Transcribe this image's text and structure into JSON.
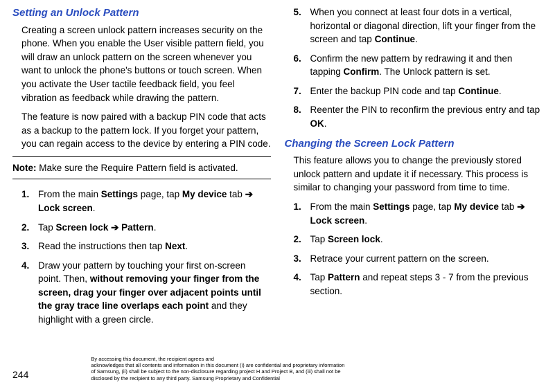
{
  "left": {
    "heading1": "Setting an Unlock Pattern",
    "para1": "Creating a screen unlock pattern increases security on the phone. When you enable the User visible pattern field, you will draw an unlock pattern on the screen whenever you want to unlock the phone's buttons or touch screen. When you activate the User tactile feedback field, you feel vibration as feedback while drawing the pattern.",
    "para2": "The feature is now paired with a backup PIN code that acts as a backup to the pattern lock. If you forget your pattern, you can regain access to the device by entering a PIN code.",
    "noteLabel": "Note:",
    "noteText": " Make sure the Require Pattern field is activated.",
    "steps": [
      {
        "num": "1.",
        "pre": "From the main ",
        "b1": "Settings",
        "mid1": " page, tap ",
        "b2": "My device",
        "mid2": " tab ",
        "arrow": "➔",
        "after": " ",
        "b3": "Lock screen",
        "end": "."
      },
      {
        "num": "2.",
        "pre": "Tap ",
        "b1": "Screen lock",
        "mid1": " ",
        "arrow": "➔",
        "mid2": " ",
        "b2": "Pattern",
        "end": "."
      },
      {
        "num": "3.",
        "pre": "Read the instructions then tap ",
        "b1": "Next",
        "end": "."
      },
      {
        "num": "4.",
        "pre": "Draw your pattern by touching your first on-screen point. Then, ",
        "b1": "without removing your finger from the screen, drag your finger over adjacent points until the gray trace line overlaps each point",
        "end": " and they highlight with a green circle."
      }
    ]
  },
  "right": {
    "stepsA": [
      {
        "num": "5.",
        "pre": "When you connect at least four dots in a vertical, horizontal or diagonal direction, lift your finger from the screen and tap ",
        "b1": "Continue",
        "end": "."
      },
      {
        "num": "6.",
        "pre": "Confirm the new pattern by redrawing it and then tapping ",
        "b1": "Confirm",
        "end": ". The Unlock pattern is set."
      },
      {
        "num": "7.",
        "pre": "Enter the backup PIN code and tap ",
        "b1": "Continue",
        "end": "."
      },
      {
        "num": "8.",
        "pre": "Reenter the PIN to reconfirm the previous entry and tap ",
        "b1": "OK",
        "end": "."
      }
    ],
    "heading2": "Changing the Screen Lock Pattern",
    "para3": "This feature allows you to change the previously stored unlock pattern and update it if necessary. This process is similar to changing your password from time to time.",
    "stepsB": [
      {
        "num": "1.",
        "pre": "From the main ",
        "b1": "Settings",
        "mid1": " page, tap ",
        "b2": "My device",
        "mid2": " tab ",
        "arrow": "➔",
        "after": " ",
        "b3": "Lock screen",
        "end": "."
      },
      {
        "num": "2.",
        "pre": "Tap ",
        "b1": "Screen lock",
        "end": "."
      },
      {
        "num": "3.",
        "pre": "Retrace your current pattern on the screen.",
        "end": ""
      },
      {
        "num": "4.",
        "pre": "Tap ",
        "b1": "Pattern",
        "end": " and repeat steps 3 - 7 from the previous section."
      }
    ]
  },
  "footer": {
    "pageNum": "244",
    "line1": "By accessing this document, the recipient agrees and",
    "line2": "acknowledges that all contents and information in this document (i) are confidential and proprietary information",
    "line3": "of Samsung, (ii) shall be subject to the non-disclosure regarding project H and Project B, and (iii) shall not be",
    "line4": "disclosed by the recipient to any third party. Samsung Proprietary and Confidential"
  }
}
